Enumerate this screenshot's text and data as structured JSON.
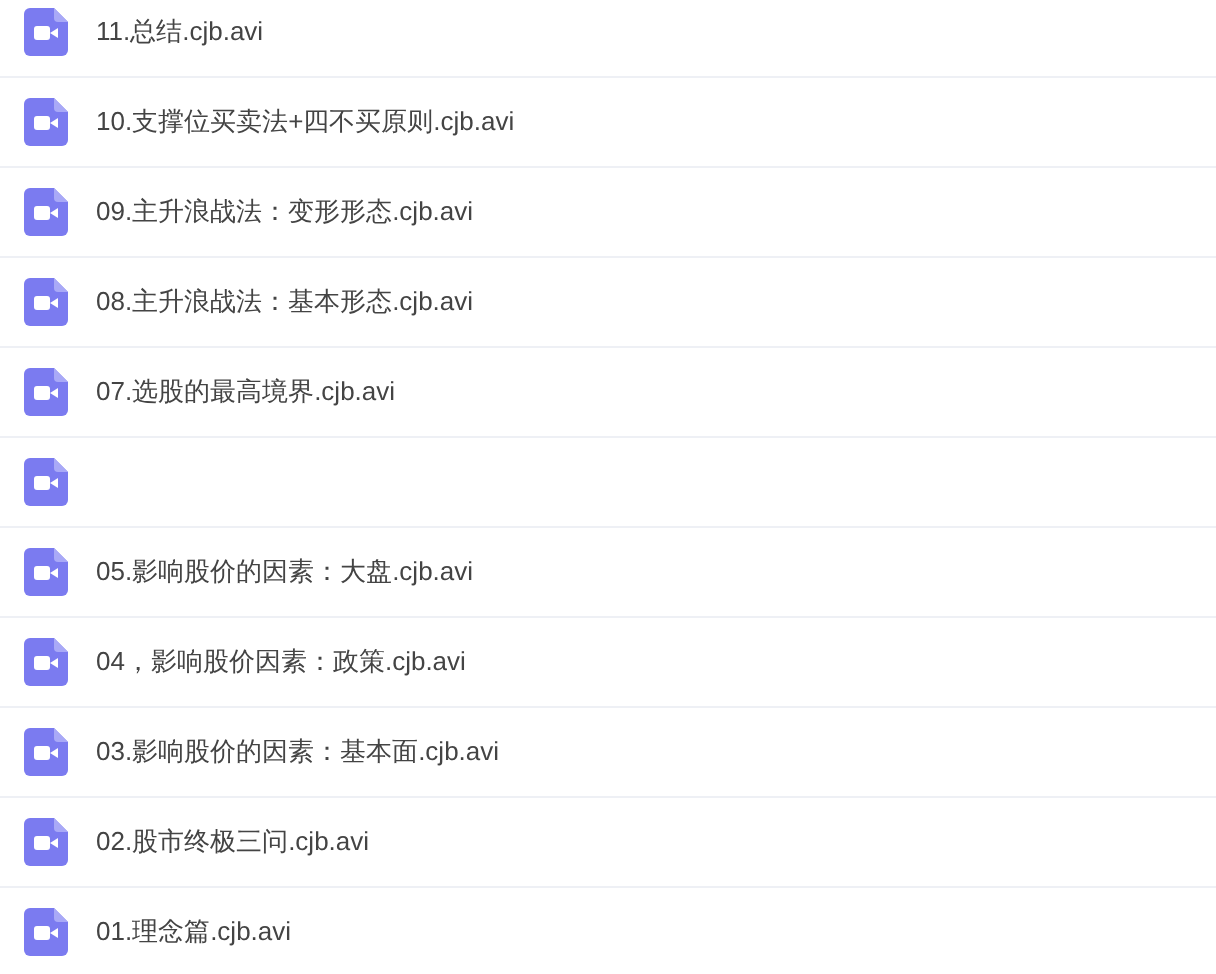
{
  "files": [
    {
      "kind": "video",
      "name": "11.总结.cjb.avi"
    },
    {
      "kind": "video",
      "name": "10.支撑位买卖法+四不买原则.cjb.avi"
    },
    {
      "kind": "video",
      "name": "09.主升浪战法：变形形态.cjb.avi"
    },
    {
      "kind": "video",
      "name": "08.主升浪战法：基本形态.cjb.avi"
    },
    {
      "kind": "video",
      "name": "07.选股的最高境界.cjb.avi"
    },
    {
      "kind": "video"
    },
    {
      "kind": "video",
      "name": "05.影响股价的因素：大盘.cjb.avi"
    },
    {
      "kind": "video",
      "name": "04，影响股价因素：政策.cjb.avi"
    },
    {
      "kind": "video",
      "name": "03.影响股价的因素：基本面.cjb.avi"
    },
    {
      "kind": "video",
      "name": "02.股市终极三问.cjb.avi"
    },
    {
      "kind": "video",
      "name": "01.理念篇.cjb.avi"
    }
  ]
}
